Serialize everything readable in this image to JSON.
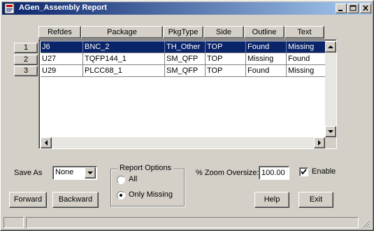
{
  "window": {
    "title": "AGen_Assembly Report"
  },
  "grid": {
    "columns": [
      "Refdes",
      "Package",
      "PkgType",
      "Side",
      "Outline",
      "Text"
    ],
    "row_numbers": [
      "1",
      "2",
      "3"
    ],
    "rows": [
      [
        "J6",
        "BNC_2",
        "TH_Other",
        "TOP",
        "Found",
        "Missing"
      ],
      [
        "U27",
        "TQFP144_1",
        "SM_QFP",
        "TOP",
        "Missing",
        "Found"
      ],
      [
        "U29",
        "PLCC68_1",
        "SM_QFP",
        "TOP",
        "Found",
        "Missing"
      ]
    ],
    "selected_row": 0
  },
  "save_as": {
    "label": "Save As",
    "value": "None"
  },
  "report_options": {
    "title": "Report Options",
    "options": [
      {
        "label": "All",
        "selected": false
      },
      {
        "label": "Only Missing",
        "selected": true
      }
    ]
  },
  "zoom": {
    "label": "% Zoom Oversize:",
    "value": "100.00"
  },
  "enable": {
    "label": "Enable",
    "checked": true
  },
  "buttons": {
    "forward": "Forward",
    "backward": "Backward",
    "help": "Help",
    "exit": "Exit"
  },
  "colors": {
    "title_start": "#0a246a",
    "title_end": "#a6caf0",
    "selection": "#0a246a",
    "face": "#d4d0c8"
  },
  "icons": {
    "app": "report-app-icon",
    "minimize": "minimize-icon",
    "maximize": "maximize-icon",
    "close": "close-icon"
  }
}
